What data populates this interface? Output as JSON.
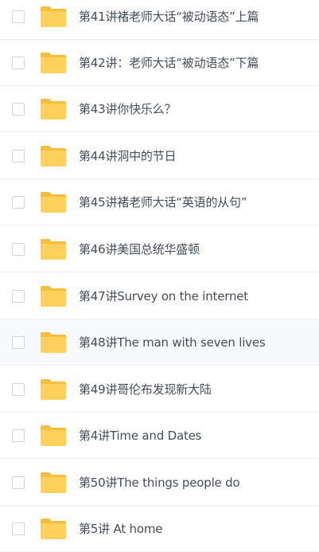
{
  "file_list": {
    "items": [
      {
        "name": "第41讲褚老师大话“被动语态”上篇",
        "hovered": false
      },
      {
        "name": "第42讲：老师大话“被动语态”下篇",
        "hovered": false
      },
      {
        "name": "第43讲你快乐么？",
        "hovered": false
      },
      {
        "name": "第44讲洞中的节日",
        "hovered": false
      },
      {
        "name": "第45讲褚老师大话“英语的从句”",
        "hovered": false
      },
      {
        "name": "第46讲美国总统华盛顿",
        "hovered": false
      },
      {
        "name": "第47讲Survey on the internet",
        "hovered": false
      },
      {
        "name": "第48讲The man with seven lives",
        "hovered": true
      },
      {
        "name": "第49讲哥伦布发现新大陆",
        "hovered": false
      },
      {
        "name": "第4讲Time and Dates",
        "hovered": false
      },
      {
        "name": "第50讲The things people do",
        "hovered": false
      },
      {
        "name": "第5讲 At home",
        "hovered": false
      }
    ]
  },
  "icons": {
    "checkbox": "checkbox-unchecked",
    "folder": "folder-icon"
  },
  "colors": {
    "folder_body": "#FFD15C",
    "folder_tab": "#F6BE3C",
    "text": "#454D5A",
    "row_border": "#EEF0F3",
    "row_hover_bg": "#F7F9FC",
    "checkbox_border": "#CFD5DD"
  }
}
